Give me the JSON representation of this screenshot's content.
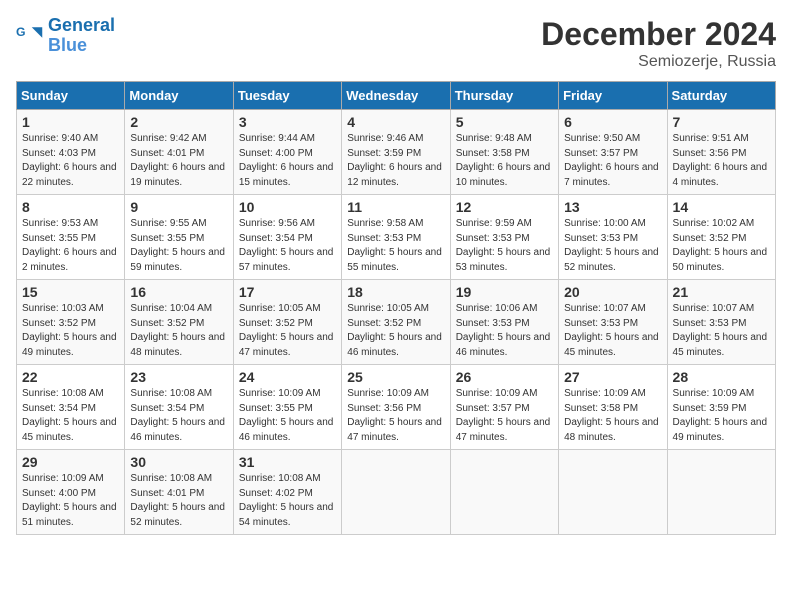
{
  "header": {
    "logo_line1": "General",
    "logo_line2": "Blue",
    "month_year": "December 2024",
    "location": "Semiozerje, Russia"
  },
  "weekdays": [
    "Sunday",
    "Monday",
    "Tuesday",
    "Wednesday",
    "Thursday",
    "Friday",
    "Saturday"
  ],
  "weeks": [
    [
      {
        "day": "1",
        "sunrise": "9:40 AM",
        "sunset": "4:03 PM",
        "daylight": "6 hours and 22 minutes."
      },
      {
        "day": "2",
        "sunrise": "9:42 AM",
        "sunset": "4:01 PM",
        "daylight": "6 hours and 19 minutes."
      },
      {
        "day": "3",
        "sunrise": "9:44 AM",
        "sunset": "4:00 PM",
        "daylight": "6 hours and 15 minutes."
      },
      {
        "day": "4",
        "sunrise": "9:46 AM",
        "sunset": "3:59 PM",
        "daylight": "6 hours and 12 minutes."
      },
      {
        "day": "5",
        "sunrise": "9:48 AM",
        "sunset": "3:58 PM",
        "daylight": "6 hours and 10 minutes."
      },
      {
        "day": "6",
        "sunrise": "9:50 AM",
        "sunset": "3:57 PM",
        "daylight": "6 hours and 7 minutes."
      },
      {
        "day": "7",
        "sunrise": "9:51 AM",
        "sunset": "3:56 PM",
        "daylight": "6 hours and 4 minutes."
      }
    ],
    [
      {
        "day": "8",
        "sunrise": "9:53 AM",
        "sunset": "3:55 PM",
        "daylight": "6 hours and 2 minutes."
      },
      {
        "day": "9",
        "sunrise": "9:55 AM",
        "sunset": "3:55 PM",
        "daylight": "5 hours and 59 minutes."
      },
      {
        "day": "10",
        "sunrise": "9:56 AM",
        "sunset": "3:54 PM",
        "daylight": "5 hours and 57 minutes."
      },
      {
        "day": "11",
        "sunrise": "9:58 AM",
        "sunset": "3:53 PM",
        "daylight": "5 hours and 55 minutes."
      },
      {
        "day": "12",
        "sunrise": "9:59 AM",
        "sunset": "3:53 PM",
        "daylight": "5 hours and 53 minutes."
      },
      {
        "day": "13",
        "sunrise": "10:00 AM",
        "sunset": "3:53 PM",
        "daylight": "5 hours and 52 minutes."
      },
      {
        "day": "14",
        "sunrise": "10:02 AM",
        "sunset": "3:52 PM",
        "daylight": "5 hours and 50 minutes."
      }
    ],
    [
      {
        "day": "15",
        "sunrise": "10:03 AM",
        "sunset": "3:52 PM",
        "daylight": "5 hours and 49 minutes."
      },
      {
        "day": "16",
        "sunrise": "10:04 AM",
        "sunset": "3:52 PM",
        "daylight": "5 hours and 48 minutes."
      },
      {
        "day": "17",
        "sunrise": "10:05 AM",
        "sunset": "3:52 PM",
        "daylight": "5 hours and 47 minutes."
      },
      {
        "day": "18",
        "sunrise": "10:05 AM",
        "sunset": "3:52 PM",
        "daylight": "5 hours and 46 minutes."
      },
      {
        "day": "19",
        "sunrise": "10:06 AM",
        "sunset": "3:53 PM",
        "daylight": "5 hours and 46 minutes."
      },
      {
        "day": "20",
        "sunrise": "10:07 AM",
        "sunset": "3:53 PM",
        "daylight": "5 hours and 45 minutes."
      },
      {
        "day": "21",
        "sunrise": "10:07 AM",
        "sunset": "3:53 PM",
        "daylight": "5 hours and 45 minutes."
      }
    ],
    [
      {
        "day": "22",
        "sunrise": "10:08 AM",
        "sunset": "3:54 PM",
        "daylight": "5 hours and 45 minutes."
      },
      {
        "day": "23",
        "sunrise": "10:08 AM",
        "sunset": "3:54 PM",
        "daylight": "5 hours and 46 minutes."
      },
      {
        "day": "24",
        "sunrise": "10:09 AM",
        "sunset": "3:55 PM",
        "daylight": "5 hours and 46 minutes."
      },
      {
        "day": "25",
        "sunrise": "10:09 AM",
        "sunset": "3:56 PM",
        "daylight": "5 hours and 47 minutes."
      },
      {
        "day": "26",
        "sunrise": "10:09 AM",
        "sunset": "3:57 PM",
        "daylight": "5 hours and 47 minutes."
      },
      {
        "day": "27",
        "sunrise": "10:09 AM",
        "sunset": "3:58 PM",
        "daylight": "5 hours and 48 minutes."
      },
      {
        "day": "28",
        "sunrise": "10:09 AM",
        "sunset": "3:59 PM",
        "daylight": "5 hours and 49 minutes."
      }
    ],
    [
      {
        "day": "29",
        "sunrise": "10:09 AM",
        "sunset": "4:00 PM",
        "daylight": "5 hours and 51 minutes."
      },
      {
        "day": "30",
        "sunrise": "10:08 AM",
        "sunset": "4:01 PM",
        "daylight": "5 hours and 52 minutes."
      },
      {
        "day": "31",
        "sunrise": "10:08 AM",
        "sunset": "4:02 PM",
        "daylight": "5 hours and 54 minutes."
      },
      null,
      null,
      null,
      null
    ]
  ]
}
